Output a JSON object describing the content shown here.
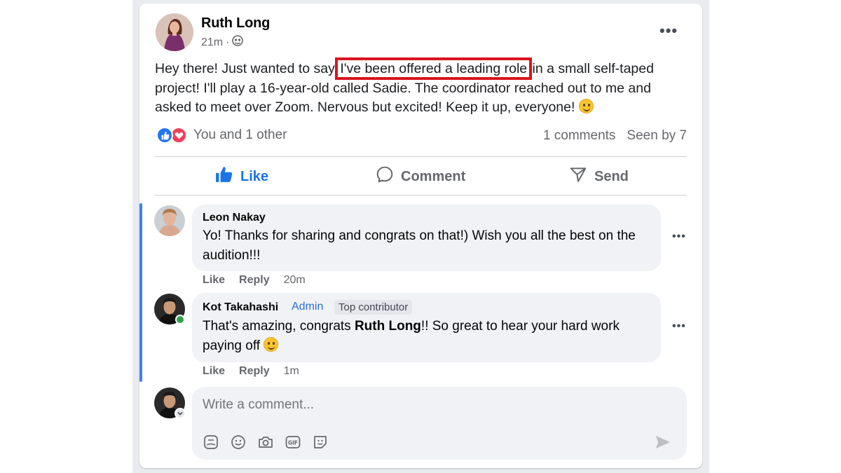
{
  "post": {
    "author": "Ruth Long",
    "time": "21m",
    "separator": "·",
    "text_before": "Hey there! Just wanted to say ",
    "text_highlight": "I've been offered a leading role",
    "text_after": " in a small self-taped project! I'll play a 16-year-old called Sadie. The coordinator reached out to me and asked to meet over Zoom. Nervous but excited! Keep it up, everyone!",
    "highlight_color": "#d9141e"
  },
  "reactions": {
    "text": "You and 1 other",
    "comments_count": "1 comments",
    "seen_by": "Seen by 7"
  },
  "actions": {
    "like": "Like",
    "comment": "Comment",
    "send": "Send",
    "like_color": "#1b74e4"
  },
  "comments": [
    {
      "name": "Leon Nakay",
      "text": "Yo! Thanks for sharing and congrats on that!) Wish you all the best on the audition!!!",
      "like": "Like",
      "reply": "Reply",
      "time": "20m"
    },
    {
      "name": "Kot Takahashi",
      "badge_admin": "Admin",
      "badge_top": "Top contributor",
      "text_before": "That's amazing, congrats ",
      "text_bold": "Ruth Long",
      "text_after": "!! So great to hear your hard work paying off",
      "like": "Like",
      "reply": "Reply",
      "time": "1m"
    }
  ],
  "composer": {
    "placeholder": "Write a comment..."
  },
  "icons": {
    "privacy": "globe-icon",
    "more": "more-horizontal-icon",
    "like": "thumbs-up-icon",
    "comment": "comment-bubble-icon",
    "send": "send-icon",
    "tools": [
      "sticker-icon",
      "emoji-icon",
      "camera-icon",
      "gif-icon",
      "avatar-sticker-icon"
    ],
    "submit": "submit-arrow-icon"
  }
}
